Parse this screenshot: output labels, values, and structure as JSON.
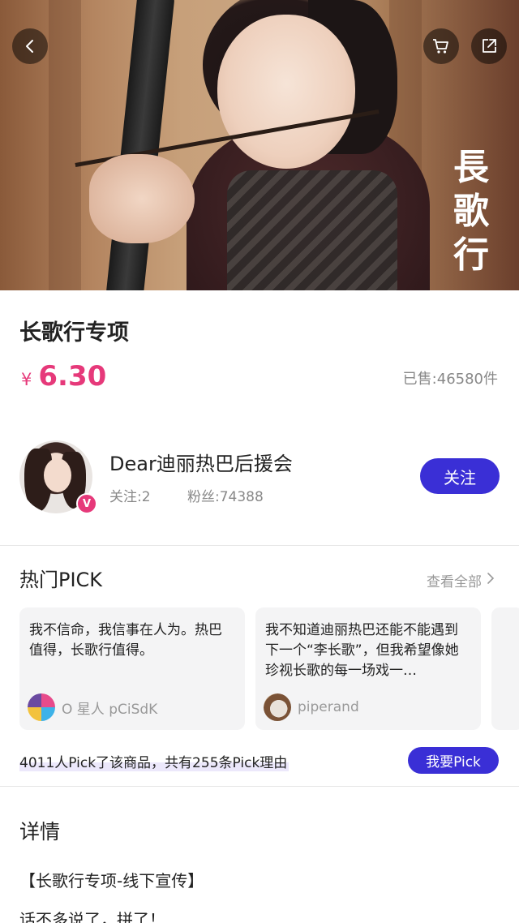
{
  "hero": {
    "calligraphy": "長歌行",
    "icons": {
      "back": "chevron-left-icon",
      "cart": "cart-icon",
      "share": "share-icon"
    }
  },
  "product": {
    "title": "长歌行专项",
    "currency": "¥",
    "price": "6.30",
    "sold": "已售:46580件"
  },
  "shop": {
    "name": "Dear迪丽热巴后援会",
    "verified_badge": "V",
    "following": "关注:2",
    "fans": "粉丝:74388",
    "follow_label": "关注"
  },
  "hot_pick": {
    "title": "热门PICK",
    "view_all": "查看全部",
    "cards": [
      {
        "text": "我不信命，我信事在人为。热巴值得，长歌行值得。",
        "user": "O 星人 pCiSdK"
      },
      {
        "text": "我不知道迪丽热巴还能不能遇到下一个“李长歌”，但我希望像她珍视长歌的每一场戏一…",
        "user": "piperand"
      }
    ],
    "summary": "4011人Pick了该商品，共有255条Pick理由",
    "pick_button": "我要Pick"
  },
  "detail": {
    "title": "详情",
    "line1": "【长歌行专项-线下宣传】",
    "line2": "话不多说了，拼了！"
  },
  "colors": {
    "accent_purple": "#3a2fd6",
    "price_pink": "#e6397a"
  }
}
